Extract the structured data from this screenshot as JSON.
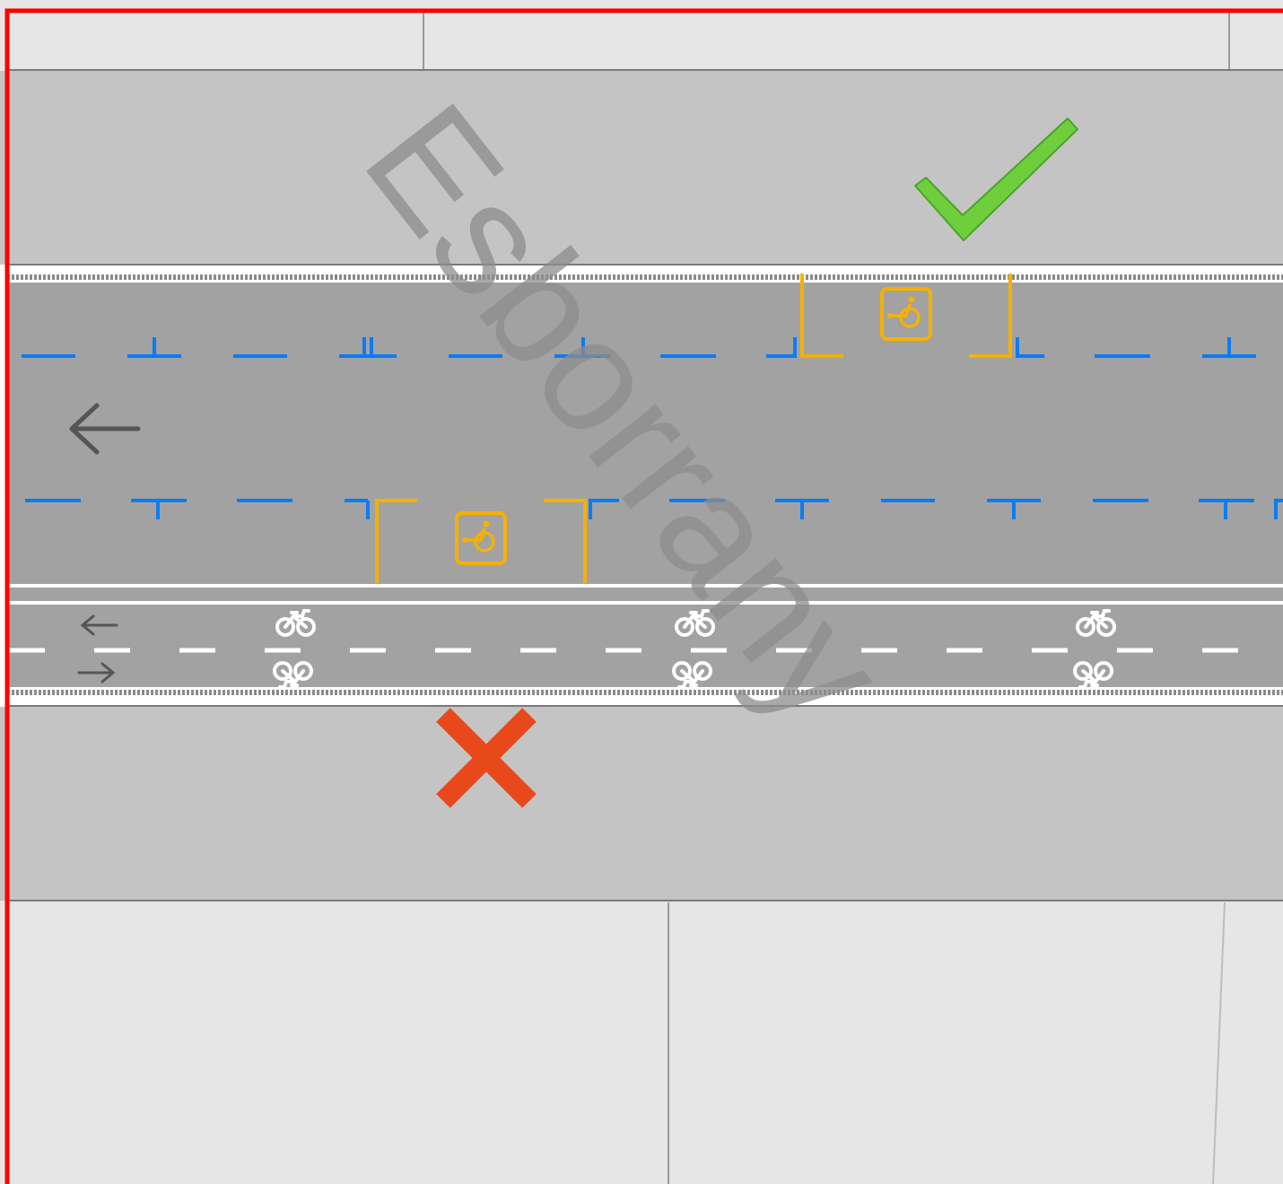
{
  "diagram": {
    "watermark": "Esborrany",
    "colors": {
      "frame": "#ff0000",
      "block_fill": "#e6e6e6",
      "sidewalk_fill": "#c4c4c4",
      "roadway_fill": "#a2a2a2",
      "parking_line": "#0a7cf4",
      "accessible_bay": "#f6b100",
      "lane_marking": "#ffffff",
      "ok_mark": "#6fce3c",
      "wrong_mark": "#e8491b",
      "arrow": "#555555"
    },
    "icons": {
      "accessible_parking": "wheelchair-icon",
      "bike_lane": "bicycle-icon",
      "correct": "check-icon",
      "incorrect": "cross-icon",
      "traffic_direction": "arrow-left-icon",
      "bike_directions": [
        "arrow-left-icon",
        "arrow-right-icon"
      ]
    },
    "elements": {
      "accessible_bays_count": 2,
      "bike_symbol_pairs": 3
    }
  }
}
